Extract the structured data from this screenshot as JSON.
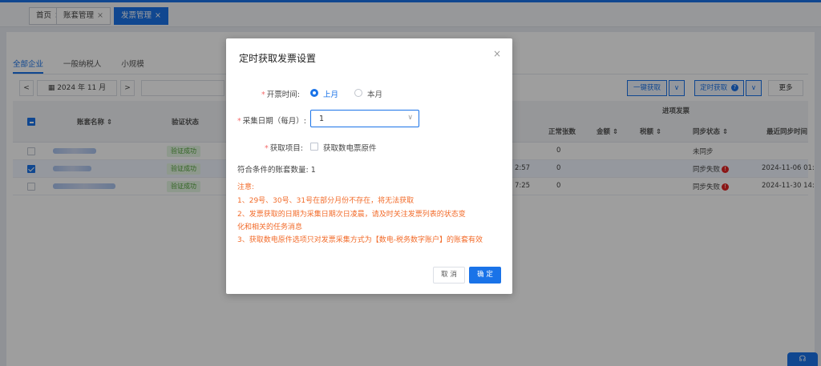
{
  "tabs": [
    {
      "label": "首页",
      "close": "×"
    },
    {
      "label": "账套管理",
      "close": "×"
    },
    {
      "label": "发票管理",
      "close": "×"
    }
  ],
  "subtabs": [
    "全部企业",
    "一般纳税人",
    "小规模"
  ],
  "toolbar": {
    "prev": "<",
    "date": "2024 年 11 月",
    "next": ">",
    "one_click_fetch": "一键获取",
    "scheduled_fetch": "定时获取",
    "more": "更多",
    "dropdown_caret": "∨"
  },
  "table": {
    "headers": {
      "account_name": "账套名称",
      "verify_status": "验证状态",
      "incoming_group": "进项发票",
      "normal_count": "正常张数",
      "amount": "金额",
      "tax": "税额",
      "sync_status": "同步状态",
      "last_sync_time": "最近同步时间",
      "sort_icon": "⇕"
    },
    "rows": [
      {
        "verify": "验证成功",
        "time_frag": "",
        "normal": "0",
        "sync": "未同步",
        "err": false,
        "last": "",
        "checked": false
      },
      {
        "verify": "验证成功",
        "time_frag": "2:57",
        "normal": "0",
        "sync": "同步失败",
        "err": true,
        "last": "2024-11-06 01:",
        "checked": true
      },
      {
        "verify": "验证成功",
        "time_frag": "7:25",
        "normal": "0",
        "sync": "同步失败",
        "err": true,
        "last": "2024-11-30 14:",
        "checked": false
      }
    ]
  },
  "modal": {
    "title": "定时获取发票设置",
    "close": "×",
    "invoice_time_label": "开票时间:",
    "opt_last_month": "上月",
    "opt_this_month": "本月",
    "collect_day_label": "采集日期（每月）:",
    "collect_day_value": "1",
    "fetch_item_label": "获取项目:",
    "fetch_item_option": "获取数电票原件",
    "count_text": "符合条件的账套数量: 1",
    "notes": [
      "注意:",
      "1、29号、30号、31号在部分月份不存在，将无法获取",
      "2、发票获取的日期为采集日期次日凌晨，请及时关注发票列表的状态变",
      "化和相关的任务消息",
      "3、获取数电原件选项只对发票采集方式为【数电-税务数字账户】的账套有效"
    ],
    "cancel": "取 消",
    "confirm": "确 定",
    "required_mark": "*"
  },
  "colors": {
    "accent": "#1a73e8",
    "warning": "#f26b2a",
    "success": "#52a43a",
    "error": "#e02424"
  },
  "icons": [
    "calendar-icon",
    "close-icon",
    "chevron-down-icon",
    "help-icon",
    "headset-icon",
    "error-icon",
    "sort-icon"
  ]
}
